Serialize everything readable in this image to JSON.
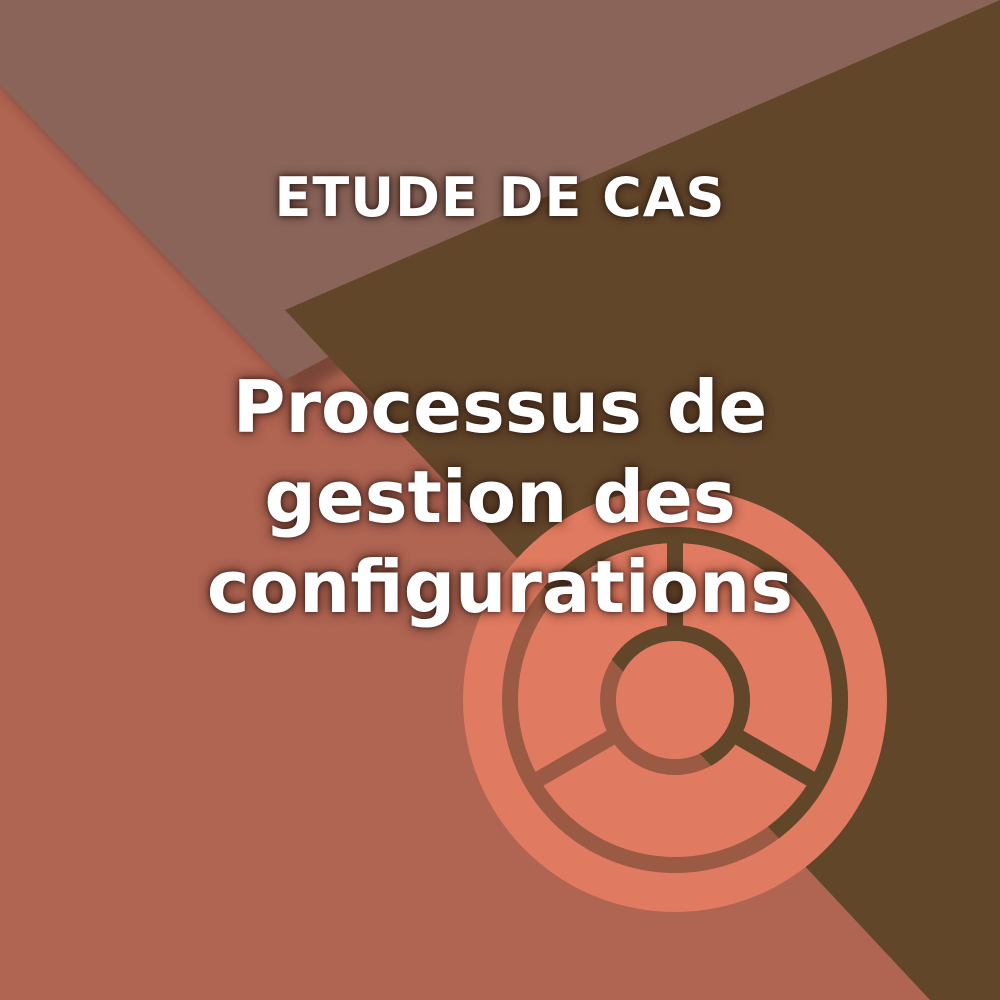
{
  "header": {
    "kicker": "ETUDE DE CAS"
  },
  "title": {
    "lines": [
      "Processus de",
      "gestion des",
      "configurations"
    ]
  },
  "icon": {
    "name": "configuration-wheel-icon"
  },
  "colors": {
    "background": "#b06452",
    "top_panel": "#8a6459",
    "right_panel": "#62462a",
    "icon_fill": "#e07a60",
    "text": "#ffffff"
  }
}
